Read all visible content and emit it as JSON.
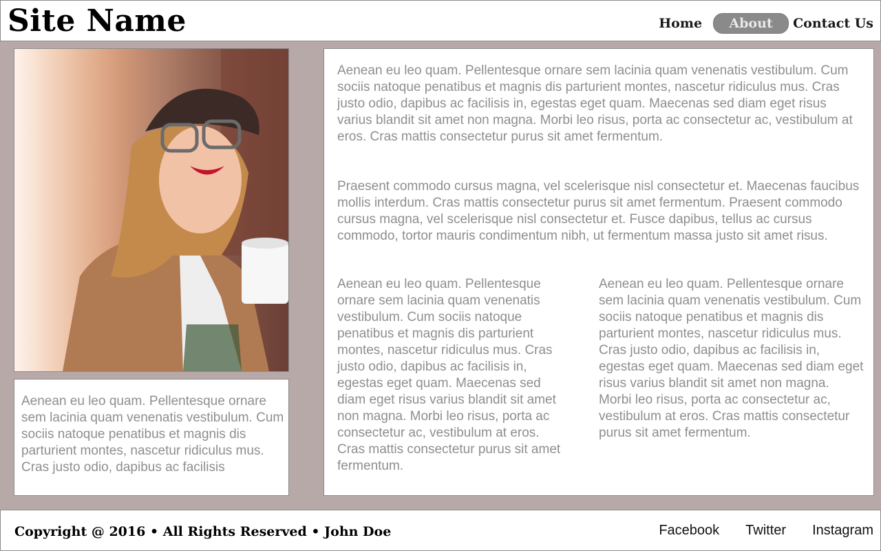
{
  "header": {
    "site_name": "Site Name",
    "nav": {
      "home": "Home",
      "about": "About",
      "contact": "Contact Us"
    }
  },
  "sidebar": {
    "text": "Aenean eu leo quam. Pellentesque ornare sem lacinia quam venenatis vestibulum. Cum sociis natoque penatibus et magnis dis parturient montes, nascetur ridiculus mus. Cras justo odio, dapibus ac facilisis"
  },
  "main": {
    "paragraph_1": "Aenean eu leo quam. Pellentesque ornare sem lacinia quam venenatis vestibulum. Cum sociis natoque penatibus et magnis dis parturient montes, nascetur ridiculus mus. Cras justo odio, dapibus ac facilisis in, egestas eget quam. Maecenas sed diam eget risus varius blandit sit amet non magna. Morbi leo risus, porta ac consectetur ac, vestibulum at eros. Cras mattis consectetur purus sit amet fermentum.",
    "paragraph_2": "Praesent commodo cursus magna, vel scelerisque nisl consectetur et. Maecenas faucibus mollis interdum. Cras mattis consectetur purus sit amet fermentum. Praesent commodo cursus magna, vel scelerisque nisl consectetur et. Fusce dapibus, tellus ac cursus commodo, tortor mauris condimentum nibh, ut fermentum massa justo sit amet risus.",
    "column_left": "Aenean eu leo quam. Pellentesque ornare sem lacinia quam venenatis vestibulum. Cum sociis natoque penatibus et magnis dis parturient montes, nascetur ridiculus mus. Cras justo odio, dapibus ac facilisis in, egestas eget quam. Maecenas sed diam eget risus varius blandit sit amet non magna. Morbi leo risus, porta ac consectetur ac, vestibulum at eros. Cras mattis consectetur purus sit amet fermentum.",
    "column_right": "Aenean eu leo quam. Pellentesque ornare sem lacinia quam venenatis vestibulum. Cum sociis natoque penatibus et magnis dis parturient montes, nascetur ridiculus mus. Cras justo odio, dapibus ac facilisis in, egestas eget quam. Maecenas sed diam eget risus varius blandit sit amet non magna. Morbi leo risus, porta ac consectetur ac, vestibulum at eros. Cras mattis consectetur purus sit amet fermentum."
  },
  "footer": {
    "copyright": "Copyright @ 2016 • All Rights Reserved • John Doe",
    "social": {
      "facebook": "Facebook",
      "twitter": "Twitter",
      "instagram": "Instagram"
    }
  },
  "colors": {
    "page_background": "#b8a9a9",
    "body_text": "#8e8e8e",
    "active_nav": "#8a8a8a"
  }
}
